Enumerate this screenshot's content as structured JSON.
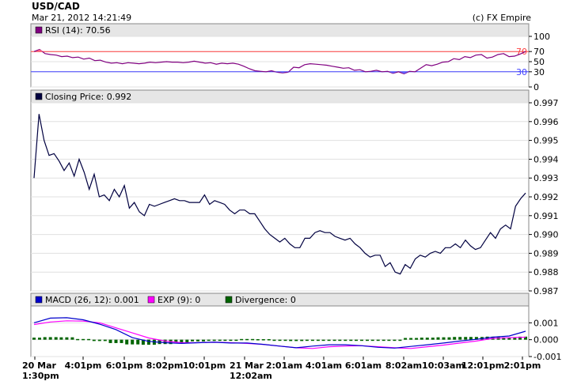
{
  "header": {
    "title": "USD/CAD",
    "datetime": "Mar 21, 2012 14:21:49",
    "copyright": "(c) FX Empire"
  },
  "colors": {
    "rsi": "#800080",
    "price": "#000040",
    "macd": "#0000cc",
    "exp": "#ff00ff",
    "divergence": "#006400",
    "ref70": "#ff4040",
    "ref30": "#4040ff",
    "panel_header": "#e6e6e6",
    "grid": "#e0e0e0"
  },
  "chart_data": [
    {
      "type": "line",
      "name": "rsi-panel",
      "legend": [
        {
          "label": "RSI (14): 70.56",
          "color": "#800080"
        }
      ],
      "ylim": [
        0,
        100
      ],
      "yticks": [
        "100",
        "70",
        "50",
        "30",
        "0"
      ],
      "ytick_values": [
        100,
        70,
        50,
        30,
        0
      ],
      "reference_lines": [
        {
          "value": 70,
          "label": "70"
        },
        {
          "value": 30,
          "label": "30"
        }
      ],
      "series": [
        {
          "values": [
            70,
            74,
            66,
            64,
            63,
            60,
            61,
            58,
            59,
            55,
            57,
            52,
            53,
            49,
            47,
            48,
            46,
            48,
            47,
            46,
            47,
            49,
            48,
            49,
            50,
            49,
            49,
            48,
            49,
            51,
            49,
            47,
            48,
            45,
            47,
            46,
            47,
            45,
            41,
            36,
            32,
            31,
            30,
            32,
            29,
            28,
            29,
            39,
            38,
            44,
            46,
            45,
            44,
            43,
            41,
            39,
            37,
            38,
            33,
            34,
            30,
            31,
            33,
            30,
            31,
            27,
            30,
            26,
            31,
            30,
            37,
            44,
            42,
            45,
            49,
            50,
            56,
            54,
            60,
            58,
            63,
            64,
            57,
            59,
            64,
            66,
            60,
            61,
            65,
            70
          ]
        }
      ]
    },
    {
      "type": "line",
      "name": "price-panel",
      "legend": [
        {
          "label": "Closing Price: 0.992",
          "color": "#000040"
        }
      ],
      "ylim": [
        0.987,
        0.997
      ],
      "yticks": [
        "0.997",
        "0.996",
        "0.995",
        "0.994",
        "0.993",
        "0.992",
        "0.991",
        "0.990",
        "0.989",
        "0.988",
        "0.987"
      ],
      "ytick_values": [
        0.997,
        0.996,
        0.995,
        0.994,
        0.993,
        0.992,
        0.991,
        0.99,
        0.989,
        0.988,
        0.987
      ],
      "series": [
        {
          "values": [
            0.993,
            0.9964,
            0.995,
            0.9942,
            0.9943,
            0.9939,
            0.9934,
            0.9938,
            0.9931,
            0.994,
            0.9933,
            0.9924,
            0.9932,
            0.992,
            0.9921,
            0.9918,
            0.9924,
            0.992,
            0.9926,
            0.9914,
            0.9917,
            0.9912,
            0.991,
            0.9916,
            0.9915,
            0.9916,
            0.9917,
            0.9918,
            0.9919,
            0.9918,
            0.9918,
            0.9917,
            0.9917,
            0.9917,
            0.9921,
            0.9916,
            0.9918,
            0.9917,
            0.9916,
            0.9913,
            0.9911,
            0.9913,
            0.9913,
            0.9911,
            0.9911,
            0.9907,
            0.9903,
            0.99,
            0.9898,
            0.9896,
            0.9898,
            0.9895,
            0.9893,
            0.9893,
            0.9898,
            0.9898,
            0.9901,
            0.9902,
            0.9901,
            0.9901,
            0.9899,
            0.9898,
            0.9897,
            0.9898,
            0.9895,
            0.9893,
            0.989,
            0.9888,
            0.9889,
            0.9889,
            0.9883,
            0.9885,
            0.988,
            0.9879,
            0.9884,
            0.9882,
            0.9887,
            0.9889,
            0.9888,
            0.989,
            0.9891,
            0.989,
            0.9893,
            0.9893,
            0.9895,
            0.9893,
            0.9897,
            0.9894,
            0.9892,
            0.9893,
            0.9897,
            0.9901,
            0.9898,
            0.9903,
            0.9905,
            0.9903,
            0.9915,
            0.9919,
            0.9922
          ]
        }
      ]
    },
    {
      "type": "line",
      "name": "macd-panel",
      "legend": [
        {
          "label": "MACD (26, 12): 0.001",
          "color": "#0000cc"
        },
        {
          "label": "EXP (9): 0",
          "color": "#ff00ff"
        },
        {
          "label": "Divergence: 0",
          "color": "#006400"
        }
      ],
      "ylim": [
        -0.001,
        0.002
      ],
      "yticks": [
        "0.001",
        "0.000",
        "-0.001"
      ],
      "ytick_values": [
        0.001,
        0.0,
        -0.001
      ],
      "x_labels": [
        {
          "line1": "20 Mar",
          "line2": "1:30pm"
        },
        {
          "line1": "4:01pm",
          "line2": ""
        },
        {
          "line1": "6:01pm",
          "line2": ""
        },
        {
          "line1": "8:02pm",
          "line2": ""
        },
        {
          "line1": "10:01pm",
          "line2": ""
        },
        {
          "line1": "21 Mar",
          "line2": "12:02am"
        },
        {
          "line1": "2:01am",
          "line2": ""
        },
        {
          "line1": "4:01am",
          "line2": ""
        },
        {
          "line1": "6:01am",
          "line2": ""
        },
        {
          "line1": "8:02am",
          "line2": ""
        },
        {
          "line1": "10:03am",
          "line2": ""
        },
        {
          "line1": "12:01pm",
          "line2": ""
        },
        {
          "line1": "2:01pm",
          "line2": ""
        }
      ],
      "series": [
        {
          "name": "MACD (26, 12)",
          "values": [
            0.001,
            0.00128,
            0.0013,
            0.00118,
            0.00092,
            0.0006,
            0.00012,
            -0.0001,
            -0.00018,
            -0.00022,
            -0.00018,
            -0.00015,
            -0.0002,
            -0.0002,
            -0.00028,
            -0.00038,
            -0.00048,
            -0.00038,
            -0.0003,
            -0.0003,
            -0.00036,
            -0.00045,
            -0.0005,
            -0.0004,
            -0.0003,
            -0.0002,
            -8e-05,
            2e-05,
            0.00015,
            0.00022,
            0.0005
          ]
        },
        {
          "name": "EXP (9)",
          "values": [
            0.0009,
            0.00105,
            0.00112,
            0.0011,
            0.001,
            0.0007,
            0.0004,
            0.0001,
            -8e-05,
            -0.00018,
            -0.00018,
            -0.00015,
            -0.00018,
            -0.00022,
            -0.00028,
            -0.00038,
            -0.00048,
            -0.00052,
            -0.00042,
            -0.00038,
            -0.00036,
            -0.00042,
            -0.00048,
            -0.00052,
            -0.00042,
            -0.00032,
            -0.0002,
            -8e-05,
            8e-05,
            0.00012,
            0.00015
          ]
        },
        {
          "name": "Divergence",
          "values": [
            0.00012,
            0.00015,
            0.00014,
            4e-05,
            -8e-05,
            -0.0002,
            -0.00028,
            -0.0003,
            -0.00026,
            -0.00016,
            -0.0001,
            -5e-05,
            -4e-05,
            4e-05,
            3e-05,
            -4e-05,
            -8e-05,
            -6e-05,
            -4e-05,
            -3e-05,
            -2e-05,
            -4e-05,
            -6e-05,
            0.0001,
            0.00012,
            0.00014,
            0.00016,
            0.00016,
            0.00018,
            0.00014,
            0.00018
          ]
        }
      ]
    }
  ]
}
